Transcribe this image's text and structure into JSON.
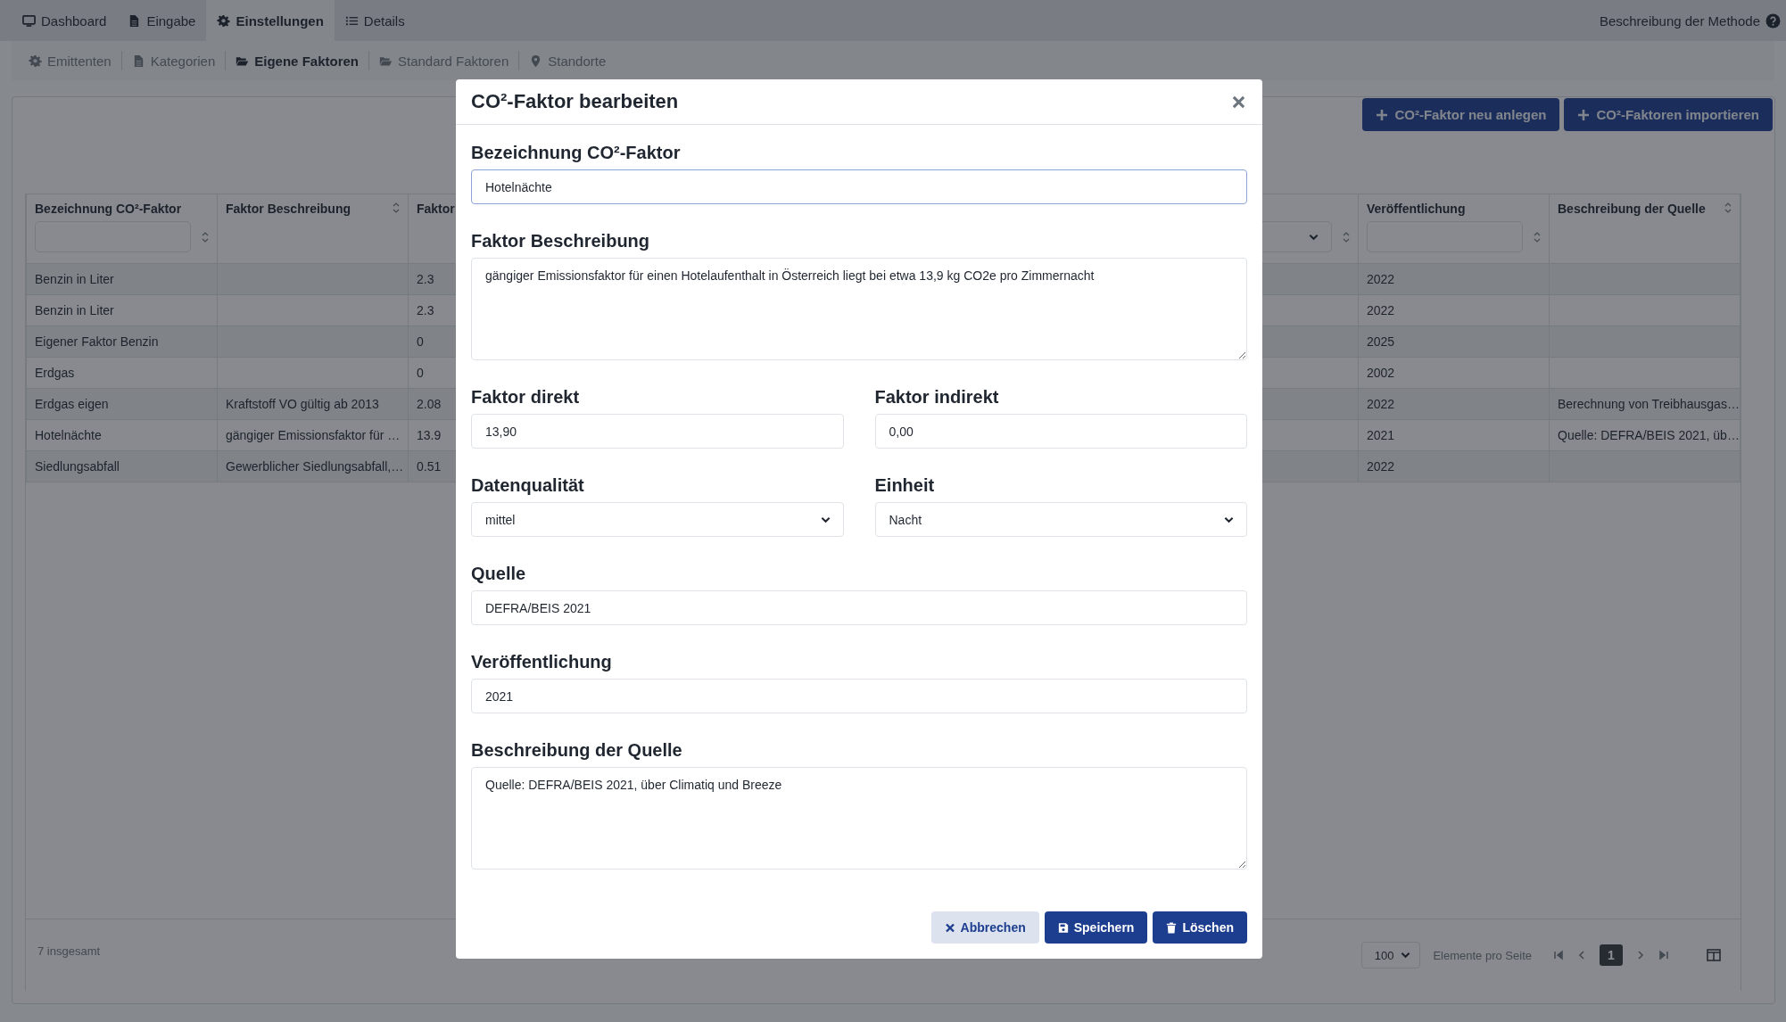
{
  "top_nav": {
    "tabs": [
      {
        "label": "Dashboard",
        "selected": false
      },
      {
        "label": "Eingabe",
        "selected": false
      },
      {
        "label": "Einstellungen",
        "selected": true
      },
      {
        "label": "Details",
        "selected": false
      }
    ],
    "help_link": "Beschreibung der Methode"
  },
  "sub_nav": {
    "items": [
      {
        "label": "Emittenten",
        "selected": false
      },
      {
        "label": "Kategorien",
        "selected": false
      },
      {
        "label": "Eigene Faktoren",
        "selected": true
      },
      {
        "label": "Standard Faktoren",
        "selected": false
      },
      {
        "label": "Standorte",
        "selected": false
      }
    ]
  },
  "toolbar": {
    "buttons": [
      "CO²-Faktor neu anlegen",
      "CO²-Faktoren importieren"
    ]
  },
  "table": {
    "columns": [
      {
        "label": "Bezeichnung CO²-Faktor",
        "kind": "text-filter"
      },
      {
        "label": "Faktor Beschreibung",
        "kind": "plain"
      },
      {
        "label": "Faktor",
        "kind": "label-only"
      },
      {
        "kind": "select-filter"
      },
      {
        "label": "Veröffentlichung",
        "kind": "text-filter"
      },
      {
        "label": "Beschreibung der Quelle",
        "kind": "plain"
      }
    ],
    "rows": [
      {
        "cells": [
          "Benzin in Liter",
          null,
          "2.3",
          null,
          "2022",
          null
        ]
      },
      {
        "cells": [
          "Benzin in Liter",
          null,
          "2.3",
          null,
          "2022",
          null
        ]
      },
      {
        "cells": [
          "Eigener Faktor Benzin",
          null,
          "0",
          null,
          "2025",
          null
        ]
      },
      {
        "cells": [
          "Erdgas",
          null,
          "0",
          null,
          "2002",
          null
        ]
      },
      {
        "cells": [
          "Erdgas eigen",
          "Kraftstoff VO gültig ab 2013",
          "2.08",
          null,
          "2022",
          "Berechnung von Treibhausgas…"
        ]
      },
      {
        "cells": [
          "Hotelnächte",
          "gängiger Emissionsfaktor für …",
          "13.9",
          null,
          "2021",
          "Quelle: DEFRA/BEIS 2021, üb…"
        ]
      },
      {
        "cells": [
          "Siedlungsabfall",
          "Gewerblicher Siedlungsabfall,…",
          "0.51",
          null,
          "2022",
          null
        ]
      }
    ]
  },
  "footer": {
    "total": "7 insgesamt",
    "page_size": "100",
    "page_size_label": "Elemente pro Seite",
    "pages": [
      {
        "label": "1",
        "selected": true
      }
    ]
  },
  "modal": {
    "title": "CO²-Faktor bearbeiten",
    "rows": [
      [
        {
          "label": "Bezeichnung CO²-Faktor",
          "kind": "input",
          "value": "Hotelnächte",
          "focused": true
        }
      ],
      [
        {
          "label": "Faktor Beschreibung",
          "kind": "textarea",
          "value": "gängiger Emissionsfaktor für einen Hotelaufenthalt in Österreich liegt bei etwa 13,9 kg CO2e pro Zimmernacht"
        }
      ],
      [
        {
          "label": "Faktor direkt",
          "kind": "input",
          "value": "13,90",
          "focused": false
        },
        {
          "label": "Faktor indirekt",
          "kind": "input",
          "value": "0,00",
          "focused": false
        }
      ],
      [
        {
          "label": "Datenqualität",
          "kind": "select",
          "value": "mittel"
        },
        {
          "label": "Einheit",
          "kind": "select",
          "value": "Nacht"
        }
      ],
      [
        {
          "label": "Quelle",
          "kind": "input",
          "value": "DEFRA/BEIS 2021",
          "focused": false
        }
      ],
      [
        {
          "label": "Veröffentlichung",
          "kind": "input",
          "value": "2021",
          "focused": false
        }
      ],
      [
        {
          "label": "Beschreibung der Quelle",
          "kind": "textarea",
          "value": "Quelle: DEFRA/BEIS 2021, über Climatiq und Breeze"
        }
      ]
    ],
    "buttons": [
      {
        "label": "Abbrechen",
        "kind": "cancel"
      },
      {
        "label": "Speichern",
        "kind": "save"
      },
      {
        "label": "Löschen",
        "kind": "delete"
      }
    ]
  }
}
